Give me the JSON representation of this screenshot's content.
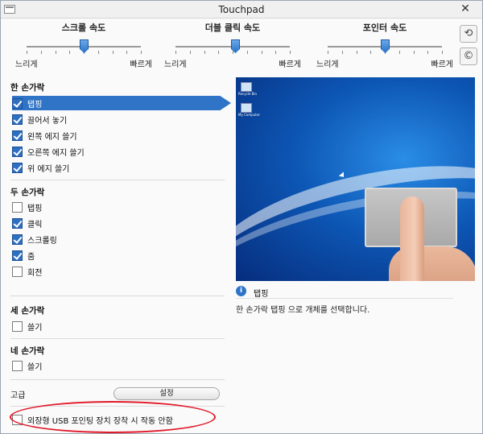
{
  "window": {
    "title": "Touchpad",
    "close_glyph": "✕"
  },
  "sliders": [
    {
      "title": "스크롤 속도",
      "min_label": "느리게",
      "max_label": "빠르게",
      "value_fraction": 0.5
    },
    {
      "title": "더블 클릭 속도",
      "min_label": "느리게",
      "max_label": "빠르게",
      "value_fraction": 0.6
    },
    {
      "title": "포인터 속도",
      "min_label": "느리게",
      "max_label": "빠르게",
      "value_fraction": 0.6
    }
  ],
  "side_buttons": {
    "reset_glyph": "⟲",
    "about_glyph": "©"
  },
  "sections": {
    "one_finger": {
      "title": "한 손가락",
      "items": [
        {
          "label": "탭핑",
          "checked": true,
          "selected": true
        },
        {
          "label": "끌어서 놓기",
          "checked": true
        },
        {
          "label": "왼쪽 에지 쓸기",
          "checked": true
        },
        {
          "label": "오른쪽 에지 쓸기",
          "checked": true
        },
        {
          "label": "위 에지 쓸기",
          "checked": true
        }
      ]
    },
    "two_finger": {
      "title": "두 손가락",
      "items": [
        {
          "label": "탭핑",
          "checked": false
        },
        {
          "label": "클릭",
          "checked": true
        },
        {
          "label": "스크롤링",
          "checked": true
        },
        {
          "label": "줌",
          "checked": true
        },
        {
          "label": "회전",
          "checked": false
        }
      ]
    },
    "three_finger": {
      "title": "세 손가락",
      "items": [
        {
          "label": "쓸기",
          "checked": false
        }
      ]
    },
    "four_finger": {
      "title": "네 손가락",
      "items": [
        {
          "label": "쓸기",
          "checked": false
        }
      ]
    }
  },
  "advanced": {
    "label": "고급",
    "settings_button": "설정"
  },
  "usb_option": {
    "label": "외장형 USB 포인팅 장치 장착 시 작동 안함",
    "checked": false
  },
  "preview": {
    "desktop_icons": [
      "Recycle Bin",
      "My Computer"
    ]
  },
  "info": {
    "title": "탭핑",
    "description": "한 손가락 탭핑 으로 개체를 선택합니다."
  },
  "colors": {
    "accent": "#2f74c6",
    "highlight_oval": "#e0192a"
  }
}
